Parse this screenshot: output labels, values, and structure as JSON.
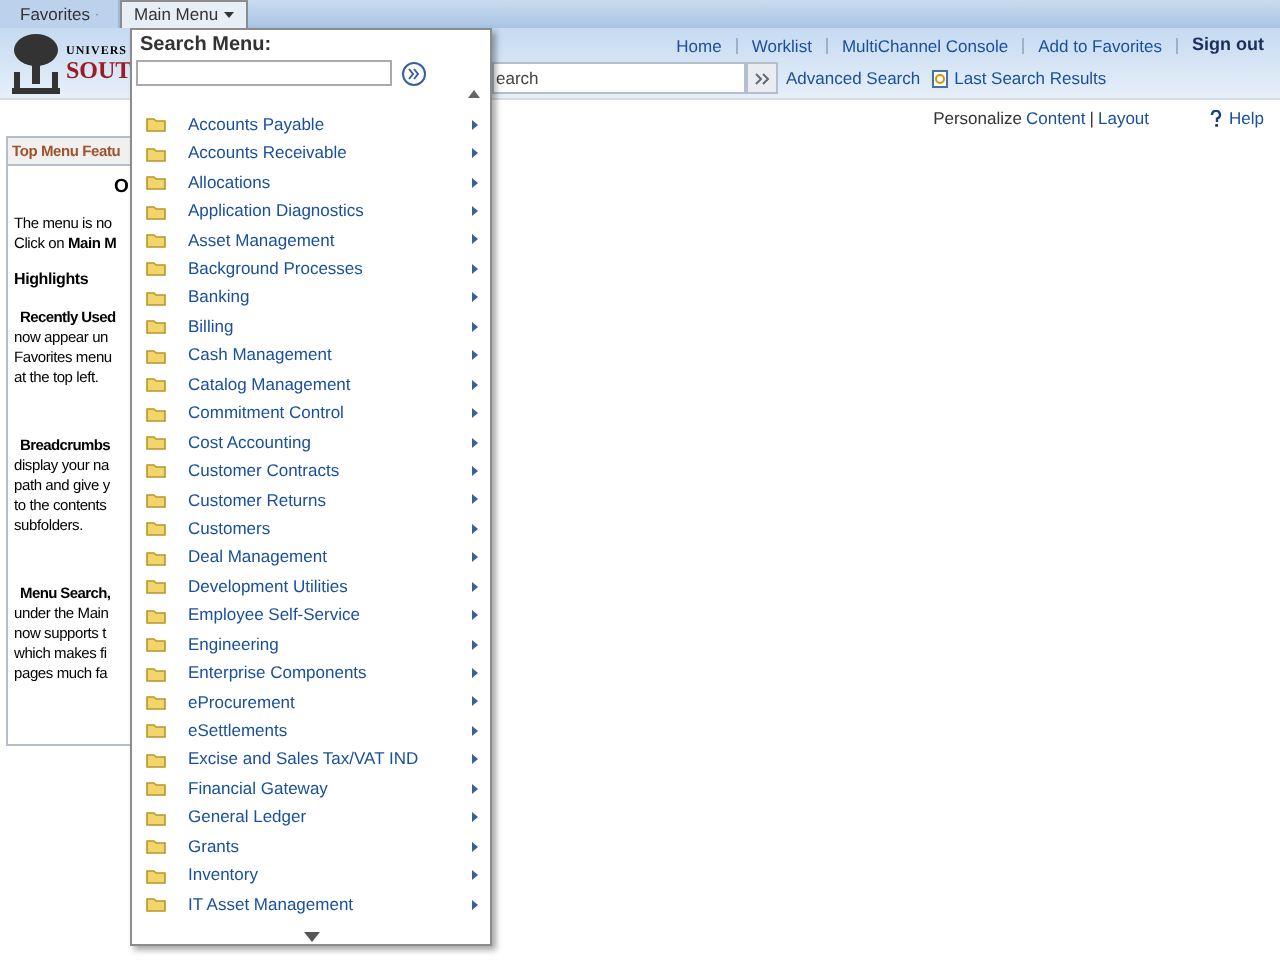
{
  "top_tabs": [
    {
      "label": "Favorites",
      "selected": false
    },
    {
      "label": "Main Menu",
      "selected": true
    }
  ],
  "logo": {
    "line_1": "UNIVERS",
    "line_2": "SOUT"
  },
  "nav_links": [
    "Home",
    "Worklist",
    "MultiChannel Console",
    "Add to Favorites",
    "Sign out"
  ],
  "header_search": {
    "placeholder": "earch",
    "links": [
      "Advanced Search",
      "Last Search Results"
    ]
  },
  "personalize": {
    "label": "Personalize",
    "links": [
      "Content",
      "Layout"
    ],
    "separator": "|",
    "help": "Help"
  },
  "left_panel": {
    "title": "Top Menu Featu",
    "lines": [
      {
        "kind": "center",
        "text": "O"
      },
      {
        "kind": "text",
        "text": "The menu is no"
      },
      {
        "kind": "text",
        "text": "Click on **Main M**"
      },
      {
        "kind": "heading",
        "text": "Highlights"
      },
      {
        "kind": "subheading",
        "text": "Recently Used"
      },
      {
        "kind": "text",
        "text": "now appear un"
      },
      {
        "kind": "text",
        "text": "Favorites menu"
      },
      {
        "kind": "text",
        "text": "at the top left."
      },
      {
        "kind": "gap"
      },
      {
        "kind": "subheading",
        "text": "Breadcrumbs"
      },
      {
        "kind": "text",
        "text": "display your na"
      },
      {
        "kind": "text",
        "text": "path and give y"
      },
      {
        "kind": "text",
        "text": "to the contents"
      },
      {
        "kind": "text",
        "text": "subfolders."
      },
      {
        "kind": "gap"
      },
      {
        "kind": "subheading",
        "text": "Menu Search,"
      },
      {
        "kind": "text",
        "text": "under the Main"
      },
      {
        "kind": "text",
        "text": "now supports t"
      },
      {
        "kind": "text",
        "text": "which makes fi"
      },
      {
        "kind": "text",
        "text": "pages much fa"
      }
    ]
  },
  "menu": {
    "search_label": "Search Menu:",
    "items": [
      {
        "label": "Accounts Payable",
        "kind": "folder"
      },
      {
        "label": "Accounts Receivable",
        "kind": "folder"
      },
      {
        "label": "Allocations",
        "kind": "folder"
      },
      {
        "label": "Application Diagnostics",
        "kind": "folder"
      },
      {
        "label": "Asset Management",
        "kind": "folder"
      },
      {
        "label": "Background Processes",
        "kind": "folder"
      },
      {
        "label": "Banking",
        "kind": "folder"
      },
      {
        "label": "Billing",
        "kind": "folder"
      },
      {
        "label": "Cash Management",
        "kind": "folder"
      },
      {
        "label": "Catalog Management",
        "kind": "folder"
      },
      {
        "label": "Commitment Control",
        "kind": "folder"
      },
      {
        "label": "Cost Accounting",
        "kind": "folder"
      },
      {
        "label": "Customer Contracts",
        "kind": "folder"
      },
      {
        "label": "Customer Returns",
        "kind": "folder"
      },
      {
        "label": "Customers",
        "kind": "folder"
      },
      {
        "label": "Deal Management",
        "kind": "folder"
      },
      {
        "label": "Development Utilities",
        "kind": "folder"
      },
      {
        "label": "Employee Self-Service",
        "kind": "folder"
      },
      {
        "label": "Engineering",
        "kind": "folder"
      },
      {
        "label": "Enterprise Components",
        "kind": "folder"
      },
      {
        "label": "eProcurement",
        "kind": "folder"
      },
      {
        "label": "eSettlements",
        "kind": "folder"
      },
      {
        "label": "Excise and Sales Tax/VAT IND",
        "kind": "folder"
      },
      {
        "label": "Financial Gateway",
        "kind": "folder"
      },
      {
        "label": "General Ledger",
        "kind": "folder"
      },
      {
        "label": "Grants",
        "kind": "folder"
      },
      {
        "label": "Inventory",
        "kind": "folder"
      },
      {
        "label": "IT Asset Management",
        "kind": "folder"
      }
    ]
  }
}
